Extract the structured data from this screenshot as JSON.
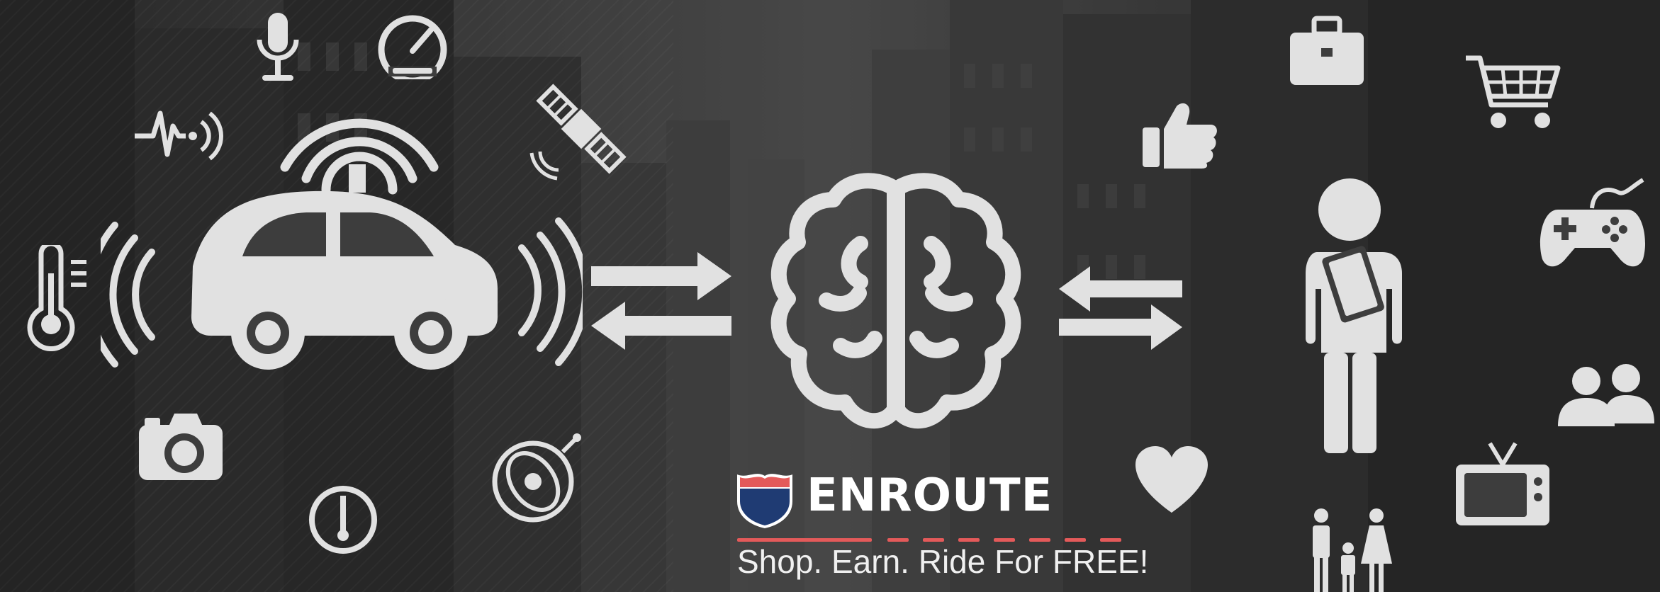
{
  "brand": {
    "name": "ENROUTE",
    "tagline": "Shop. Earn. Ride For FREE!"
  },
  "colors": {
    "icon": "#e1e1e1",
    "accent_red": "#e45a5a",
    "shield_blue": "#1f3b73",
    "text": "#ffffff"
  },
  "icons": {
    "left": [
      "microphone-icon",
      "speedometer-icon",
      "heartbeat-signal-icon",
      "satellite-icon",
      "self-driving-car-icon",
      "thermometer-icon",
      "camera-icon",
      "gauge-icon",
      "orbit-compass-icon"
    ],
    "center": [
      "brain-icon",
      "exchange-arrows-left-icon",
      "exchange-arrows-right-icon"
    ],
    "right": [
      "briefcase-icon",
      "thumbs-up-icon",
      "shopping-cart-icon",
      "person-with-tablet-icon",
      "gamepad-icon",
      "group-icon",
      "heart-icon",
      "television-icon",
      "family-icon"
    ]
  }
}
